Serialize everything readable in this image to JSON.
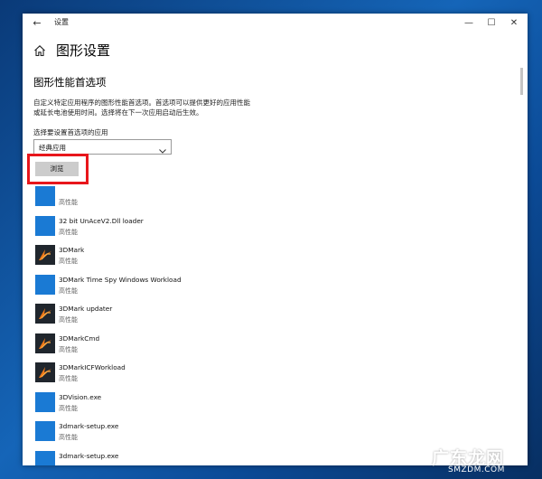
{
  "window": {
    "title": "设置",
    "back_icon": "arrow-left-icon",
    "controls": [
      "minimize-icon",
      "maximize-icon",
      "close-icon"
    ]
  },
  "page": {
    "home_icon": "home-icon",
    "title": "图形设置",
    "section_title": "图形性能首选项",
    "description_line1": "自定义特定应用程序的图形性能首选项。首选项可以提供更好的应用性能",
    "description_line2": "或延长电池使用时间。选择将在下一次应用启动后生效。",
    "select_label": "选择要设置首选项的应用",
    "dropdown_value": "经典应用",
    "browse_label": "浏览"
  },
  "colors": {
    "accent_tile": "#1a7ad4",
    "highlight_box": "#e8161b",
    "dark_tile": "#20262d"
  },
  "apps": [
    {
      "name": "",
      "perf": "高性能",
      "icon": "blue-app-tile-icon"
    },
    {
      "name": "32 bit UnAceV2.Dll loader",
      "perf": "高性能",
      "icon": "blue-app-tile-icon"
    },
    {
      "name": "3DMark",
      "perf": "高性能",
      "icon": "3dmark-icon"
    },
    {
      "name": "3DMark Time Spy Windows Workload",
      "perf": "高性能",
      "icon": "blue-app-tile-icon"
    },
    {
      "name": "3DMark updater",
      "perf": "高性能",
      "icon": "3dmark-icon"
    },
    {
      "name": "3DMarkCmd",
      "perf": "高性能",
      "icon": "3dmark-icon"
    },
    {
      "name": "3DMarkICFWorkload",
      "perf": "高性能",
      "icon": "3dmark-icon"
    },
    {
      "name": "3DVision.exe",
      "perf": "高性能",
      "icon": "blue-app-tile-icon"
    },
    {
      "name": "3dmark-setup.exe",
      "perf": "高性能",
      "icon": "blue-app-tile-icon"
    },
    {
      "name": "3dmark-setup.exe",
      "perf": "",
      "icon": "blue-app-tile-icon"
    }
  ],
  "watermark": {
    "main": "广东龙网",
    "sub": "SMZDM.COM"
  }
}
